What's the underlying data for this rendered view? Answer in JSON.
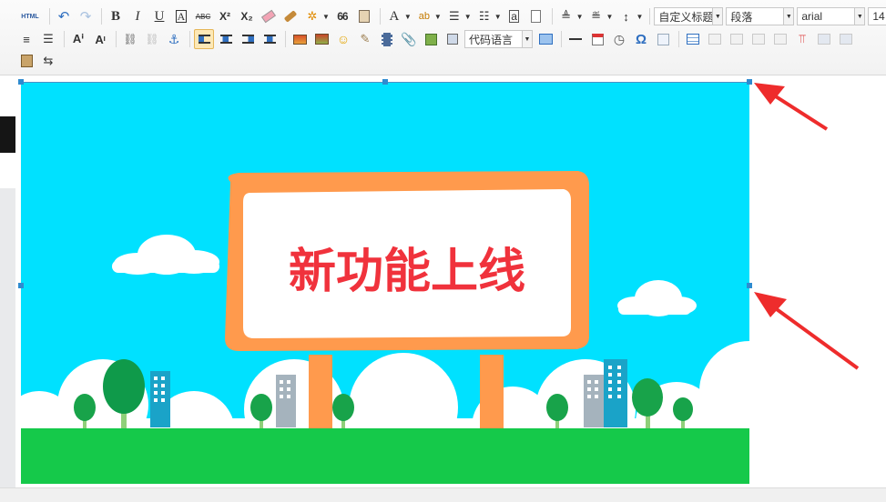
{
  "toolbar": {
    "html_label": "HTML",
    "bold_label": "B",
    "italic_label": "I",
    "underline_label": "U",
    "font_border_label": "A",
    "strike_label": "ABC",
    "superscript_label": "X²",
    "subscript_label": "X₂",
    "quote_label": "66",
    "font_color_label": "A",
    "custom_title_value": "自定义标题",
    "paragraph_value": "段落",
    "font_family_value": "arial",
    "font_size_value": "14",
    "code_language_value": "代码语言",
    "omega_label": "Ω"
  },
  "content": {
    "image_title_text": "新功能上线"
  },
  "colors": {
    "sky": "#00e1ff",
    "ground": "#15c94a",
    "board": "#ff9a4d",
    "title_red": "#f0323c",
    "arrow_red": "#ee2c2c",
    "handle_blue": "#2f8bd0"
  }
}
